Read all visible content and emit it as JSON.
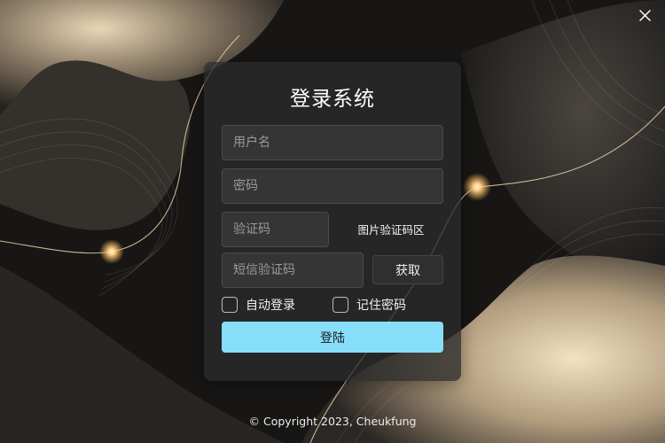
{
  "window": {
    "close_icon": "close-icon"
  },
  "login": {
    "title": "登录系统",
    "username_placeholder": "用户名",
    "password_placeholder": "密码",
    "captcha_placeholder": "验证码",
    "captcha_image_label": "图片验证码区",
    "sms_placeholder": "短信验证码",
    "get_sms_label": "获取",
    "auto_login_label": "自动登录",
    "remember_password_label": "记住密码",
    "login_button_label": "登陆"
  },
  "footer": {
    "copyright": "© Copyright 2023, Cheukfung"
  },
  "colors": {
    "background": "#161514",
    "accent_button": "#87def9",
    "card": "#2c2c2c",
    "wave_highlight": "#e9d5b4"
  }
}
